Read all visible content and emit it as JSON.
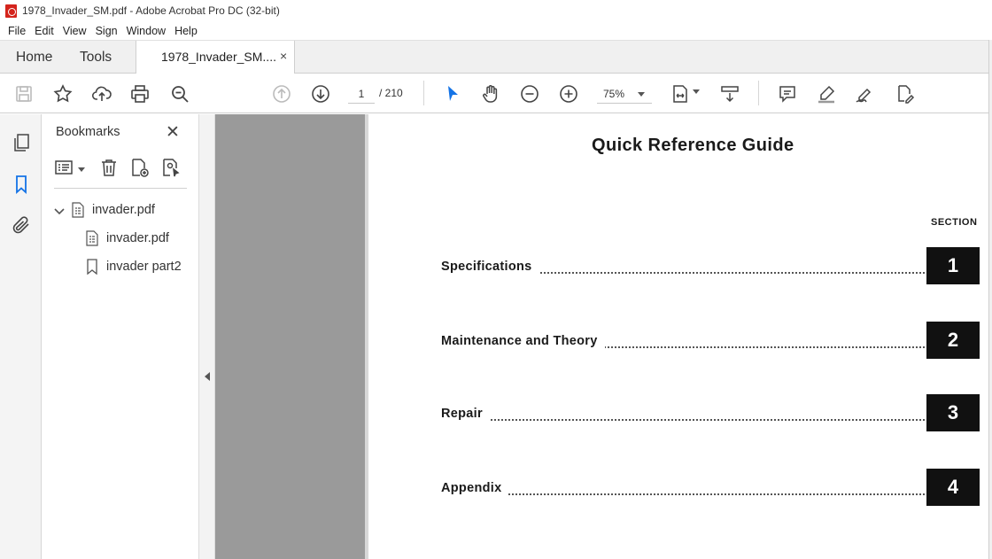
{
  "window": {
    "title": "1978_Invader_SM.pdf - Adobe Acrobat Pro DC (32-bit)"
  },
  "menu": [
    "File",
    "Edit",
    "View",
    "Sign",
    "Window",
    "Help"
  ],
  "tabs": {
    "home": "Home",
    "tools": "Tools",
    "doc": "1978_Invader_SM....",
    "close": "×"
  },
  "toolbar": {
    "page_current": "1",
    "page_total": "/ 210",
    "zoom": "75%"
  },
  "bookmarks": {
    "title": "Bookmarks",
    "close": "✕",
    "items": [
      {
        "label": "invader.pdf",
        "expanded": true
      },
      {
        "label": "invader.pdf"
      },
      {
        "label": "invader part2"
      }
    ]
  },
  "document": {
    "title": "Quick Reference Guide",
    "section_label": "SECTION",
    "toc": [
      {
        "label": "Specifications",
        "number": "1"
      },
      {
        "label": "Maintenance and Theory",
        "number": "2"
      },
      {
        "label": "Repair",
        "number": "3"
      },
      {
        "label": "Appendix",
        "number": "4"
      }
    ]
  },
  "colors": {
    "accent_blue": "#1473e6",
    "pdf_red": "#d4241c"
  }
}
